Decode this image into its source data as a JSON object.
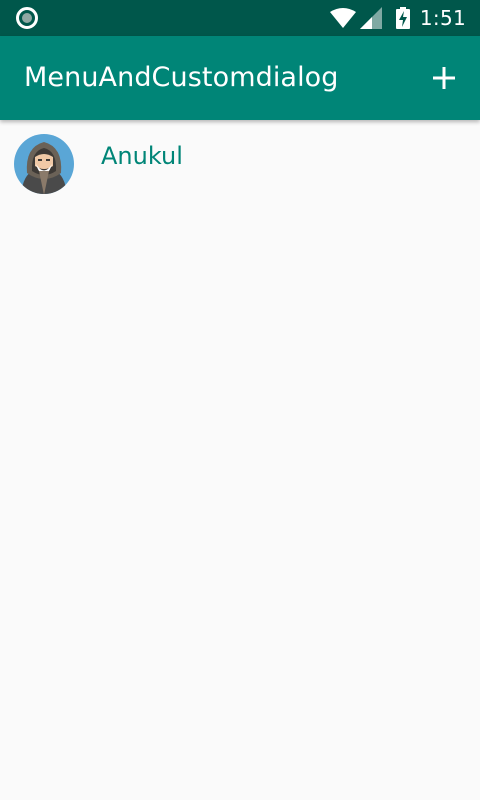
{
  "status_bar": {
    "time": "1:51",
    "icons": [
      "notification-circle-icon",
      "wifi-icon",
      "cell-signal-icon",
      "battery-charging-icon"
    ]
  },
  "app_bar": {
    "title": "MenuAndCustomdialog",
    "action_icon": "add-icon"
  },
  "list": {
    "items": [
      {
        "name": "Anukul",
        "avatar_icon": "hooded-man-avatar-icon"
      }
    ]
  },
  "colors": {
    "status_bar": "#00574b",
    "primary": "#008577",
    "background": "#fafafa",
    "accent_text": "#008577"
  }
}
